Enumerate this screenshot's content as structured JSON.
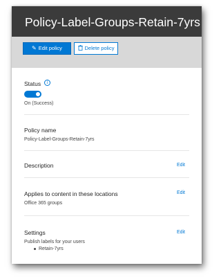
{
  "header": {
    "title": "Policy-Label-Groups-Retain-7yrs"
  },
  "toolbar": {
    "edit_label": "Edit policy",
    "delete_label": "Delete policy"
  },
  "status": {
    "label": "Status",
    "toggle_on": true,
    "value": "On (Success)"
  },
  "policy_name": {
    "label": "Policy name",
    "value": "Policy-Label-Groups-Retain-7yrs"
  },
  "description": {
    "label": "Description",
    "edit_label": "Edit"
  },
  "locations": {
    "label": "Applies to content in these locations",
    "edit_label": "Edit",
    "value": "Office 365 groups"
  },
  "settings": {
    "label": "Settings",
    "edit_label": "Edit",
    "value": "Publish labels for your users",
    "items": [
      "Retain-7yrs"
    ]
  },
  "colors": {
    "accent": "#0078d4",
    "titlebar": "#3b3b3b",
    "toolbar": "#d8d8d8"
  }
}
